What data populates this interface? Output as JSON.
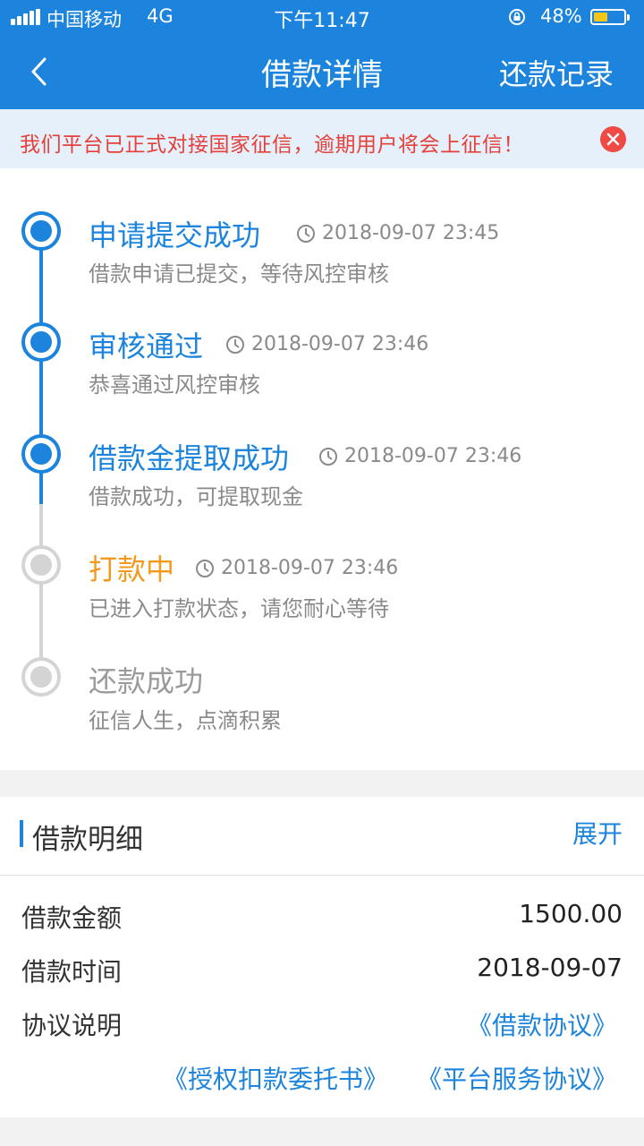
{
  "status_bar": {
    "carrier": "中国移动",
    "network": "4G",
    "time": "下午11:47",
    "battery": "48%",
    "battery_level": 0.48
  },
  "nav": {
    "title": "借款详情",
    "right_action": "还款记录"
  },
  "notice": {
    "text": "我们平台已正式对接国家征信，逾期用户将会上征信！"
  },
  "timeline": [
    {
      "title": "申请提交成功",
      "time": "2018-09-07 23:45",
      "desc": "借款申请已提交，等待风控审核",
      "state": "done",
      "color": "#1c84dc"
    },
    {
      "title": "审核通过",
      "time": "2018-09-07 23:46",
      "desc": "恭喜通过风控审核",
      "state": "done",
      "color": "#1c84dc"
    },
    {
      "title": "借款金提取成功",
      "time": "2018-09-07 23:46",
      "desc": "借款成功，可提取现金",
      "state": "done",
      "color": "#1c84dc"
    },
    {
      "title": "打款中",
      "time": "2018-09-07 23:46",
      "desc": "已进入打款状态，请您耐心等待",
      "state": "current",
      "color": "#f39a1e"
    },
    {
      "title": "还款成功",
      "time": "",
      "desc": "征信人生，点滴积累",
      "state": "todo",
      "color": "#9a9a9a"
    }
  ],
  "detail": {
    "title": "借款明细",
    "expand": "展开",
    "amount_label": "借款金额",
    "amount_value": "1500.00",
    "date_label": "借款时间",
    "date_value": "2018-09-07",
    "agreement_label": "协议说明",
    "links": [
      "《借款协议》",
      "《授权扣款委托书》",
      "《平台服务协议》"
    ]
  },
  "colors": {
    "primary": "#1c84dc",
    "warning": "#e5403b",
    "pending": "#f39a1e"
  }
}
